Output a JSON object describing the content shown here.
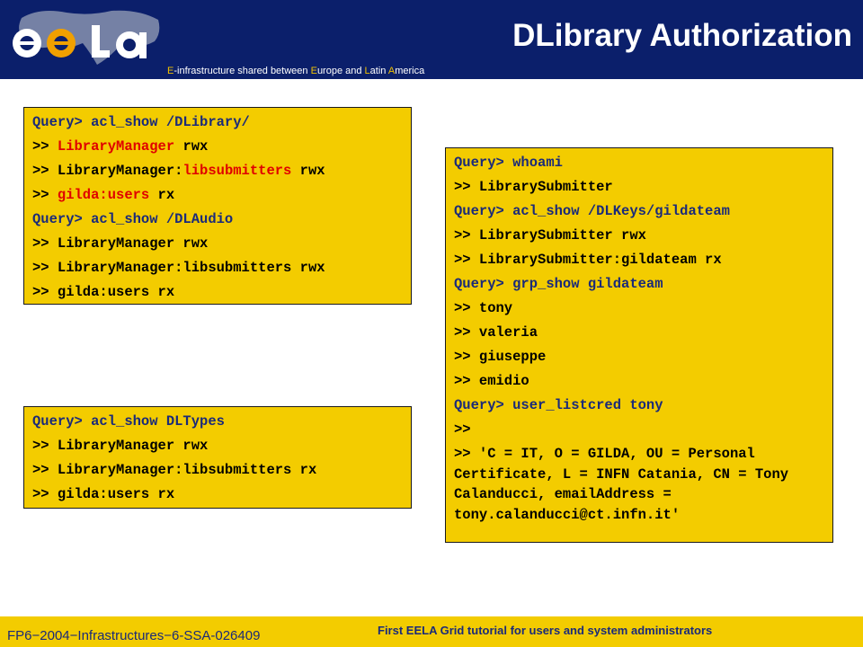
{
  "header": {
    "title": "DLibrary Authorization",
    "logo_name": "eela-logo",
    "tagline": {
      "p1": "E",
      "p2": "-infrastructure shared between ",
      "p3": "E",
      "p4": "urope and ",
      "p5": "L",
      "p6": "atin ",
      "p7": "A",
      "p8": "merica"
    }
  },
  "box1": {
    "l1": "Query> acl_show /DLibrary/",
    "l2": {
      "pre": ">> ",
      "red": "LibraryManager",
      "post": " rwx"
    },
    "l3": {
      "pre": ">> LibraryManager:",
      "red": "libsubmitters",
      "post": " rwx"
    },
    "l4": {
      "pre": ">> ",
      "red": "gilda:users",
      "post": " rx"
    },
    "l5": "Query> acl_show /DLAudio",
    "l6": ">> LibraryManager rwx",
    "l7": ">> LibraryManager:libsubmitters rwx",
    "l8": ">> gilda:users rx"
  },
  "box2": {
    "l1": "Query> acl_show DLTypes",
    "l2": ">> LibraryManager rwx",
    "l3": ">> LibraryManager:libsubmitters rx",
    "l4": ">> gilda:users rx"
  },
  "box3": {
    "l1": "Query> whoami",
    "l2": ">> LibrarySubmitter",
    "l3": "Query> acl_show /DLKeys/gildateam",
    "l4": ">> LibrarySubmitter rwx",
    "l5": ">> LibrarySubmitter:gildateam rx",
    "l6": "Query> grp_show gildateam",
    "l7": ">> tony",
    "l8": ">> valeria",
    "l9": ">> giuseppe",
    "l10": ">> emidio",
    "l11": "Query> user_listcred tony",
    "l12": ">>",
    "l13": ">> 'C = IT, O = GILDA, OU = Personal Certificate, L = INFN Catania, CN = Tony Calanducci, emailAddress = tony.calanducci@ct.infn.it'"
  },
  "footer": {
    "left": "FP6−2004−Infrastructures−6-SSA-026409",
    "right": "First EELA Grid tutorial for users and system administrators"
  },
  "colors": {
    "header_bg": "#0b1f6b",
    "box_bg": "#f3cc00",
    "query_text": "#1a2a7a",
    "highlight_red": "#e00000",
    "tagline_accent": "#f0c000"
  }
}
